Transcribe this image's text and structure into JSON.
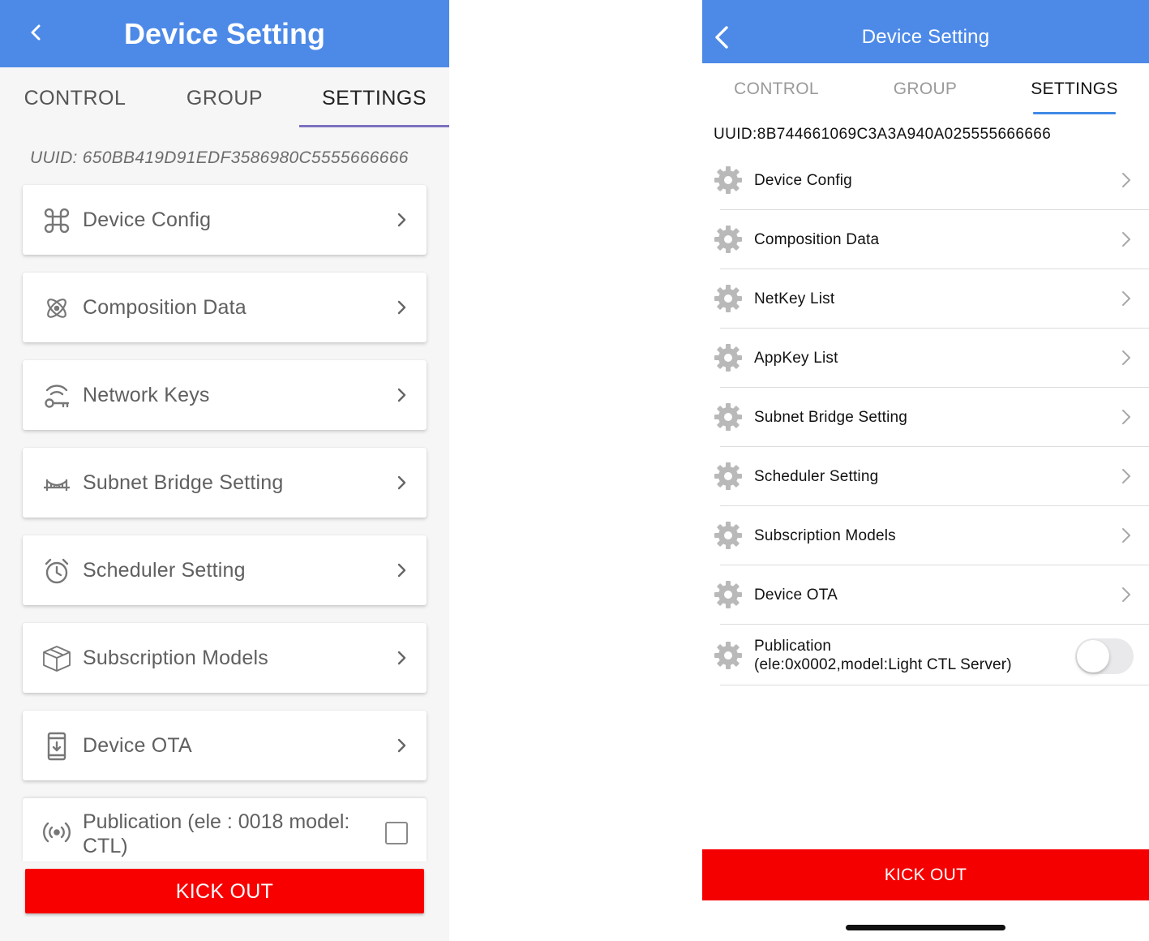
{
  "left_app": {
    "header": {
      "title": "Device Setting",
      "back_icon": "chevron-left-icon"
    },
    "tabs": [
      {
        "label": "CONTROL"
      },
      {
        "label": "GROUP"
      },
      {
        "label": "SETTINGS"
      }
    ],
    "active_tab": "SETTINGS",
    "uuid_text": "UUID: 650BB419D91EDF3586980C5555666666",
    "items": [
      {
        "label": "Device Config",
        "icon": "command-key-icon"
      },
      {
        "label": "Composition Data",
        "icon": "atom-icon"
      },
      {
        "label": "Network Keys",
        "icon": "wifi-key-icon"
      },
      {
        "label": "Subnet Bridge Setting",
        "icon": "bridge-icon"
      },
      {
        "label": "Scheduler Setting",
        "icon": "alarm-clock-icon"
      },
      {
        "label": "Subscription Models",
        "icon": "cube-icon"
      },
      {
        "label": "Device OTA",
        "icon": "phone-download-icon"
      }
    ],
    "publication": {
      "label": "Publication (ele : 0018 model: CTL)",
      "icon": "broadcast-icon",
      "checked": false
    },
    "kick_out_label": "KICK OUT",
    "colors": {
      "header": "#4d8ae8",
      "tab_indicator": "#7b72c0",
      "kick_out": "#f80000"
    }
  },
  "right_app": {
    "header": {
      "title": "Device Setting",
      "back_icon": "chevron-left-icon"
    },
    "tabs": [
      {
        "label": "CONTROL"
      },
      {
        "label": "GROUP"
      },
      {
        "label": "SETTINGS"
      }
    ],
    "active_tab": "SETTINGS",
    "uuid_text": "UUID:8B744661069C3A3A940A025555666666",
    "items": [
      {
        "label": "Device Config",
        "icon": "gear-icon"
      },
      {
        "label": "Composition Data",
        "icon": "gear-icon"
      },
      {
        "label": "NetKey List",
        "icon": "gear-icon"
      },
      {
        "label": "AppKey List",
        "icon": "gear-icon"
      },
      {
        "label": "Subnet Bridge Setting",
        "icon": "gear-icon"
      },
      {
        "label": "Scheduler Setting",
        "icon": "gear-icon"
      },
      {
        "label": "Subscription Models",
        "icon": "gear-icon"
      },
      {
        "label": "Device OTA",
        "icon": "gear-icon"
      }
    ],
    "publication": {
      "line1": "Publication",
      "line2": "(ele:0x0002,model:Light CTL Server)",
      "icon": "gear-icon",
      "enabled": false
    },
    "kick_out_label": "KICK OUT",
    "colors": {
      "header": "#4d8ae8",
      "tab_indicator": "#3f8ae6",
      "kick_out": "#f50000"
    }
  }
}
